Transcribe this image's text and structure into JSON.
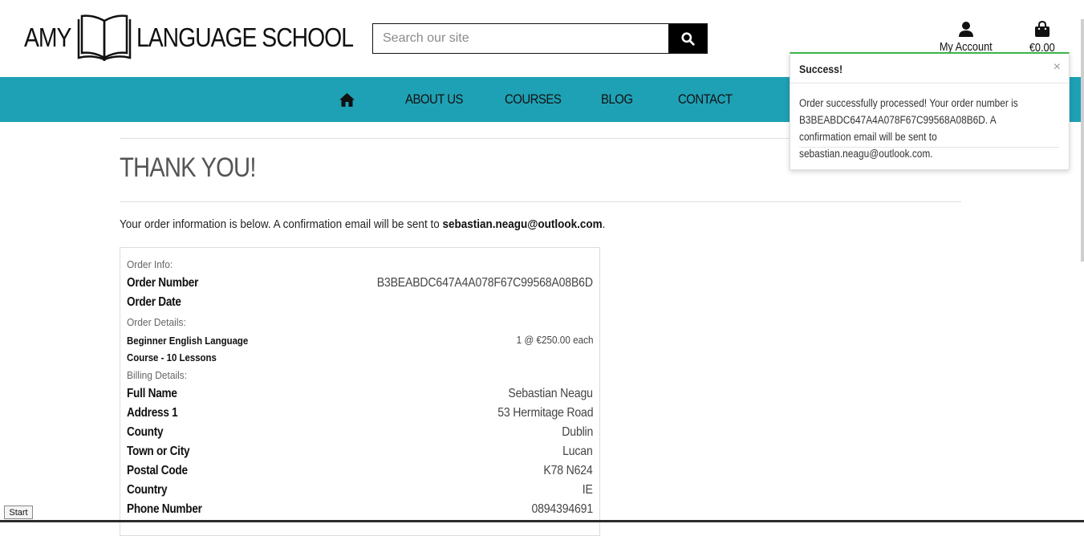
{
  "brand": {
    "name_left": "AMY",
    "name_right": "LANGUAGE SCHOOL"
  },
  "search": {
    "placeholder": "Search our site"
  },
  "header": {
    "account_label": "My Account",
    "cart_total": "€0.00"
  },
  "nav": {
    "items": [
      "ABOUT US",
      "COURSES",
      "BLOG",
      "CONTACT"
    ]
  },
  "page": {
    "title": "THANK YOU!",
    "intro_text": "Your order information is below. A confirmation email will be sent to ",
    "intro_email": "sebastian.neagu@outlook.com",
    "intro_end": "."
  },
  "order": {
    "info_heading": "Order Info:",
    "number_label": "Order Number",
    "number_value": "B3BEABDC647A4A078F67C99568A08B6D",
    "date_label": "Order Date",
    "details_heading": "Order Details:",
    "item_name": "Beginner English Language Course - 10 Lessons",
    "item_qty_price": "1 @ €250.00 each",
    "billing_heading": "Billing Details:",
    "billing": [
      {
        "label": "Full Name",
        "value": "Sebastian Neagu"
      },
      {
        "label": "Address 1",
        "value": "53 Hermitage Road"
      },
      {
        "label": "County",
        "value": "Dublin"
      },
      {
        "label": "Town or City",
        "value": "Lucan"
      },
      {
        "label": "Postal Code",
        "value": "K78 N624"
      },
      {
        "label": "Country",
        "value": "IE"
      },
      {
        "label": "Phone Number",
        "value": "0894394691"
      }
    ]
  },
  "toast": {
    "title": "Success!",
    "close": "×",
    "message": "Order successfully processed! Your order number is B3BEABDC647A4A078F67C99568A08B6D. A confirmation email will be sent to sebastian.neagu@outlook.com."
  },
  "taskbar": {
    "start_label": "Start"
  },
  "colors": {
    "nav_bg": "#1fa1b5",
    "toast_accent": "#3cb44b"
  }
}
